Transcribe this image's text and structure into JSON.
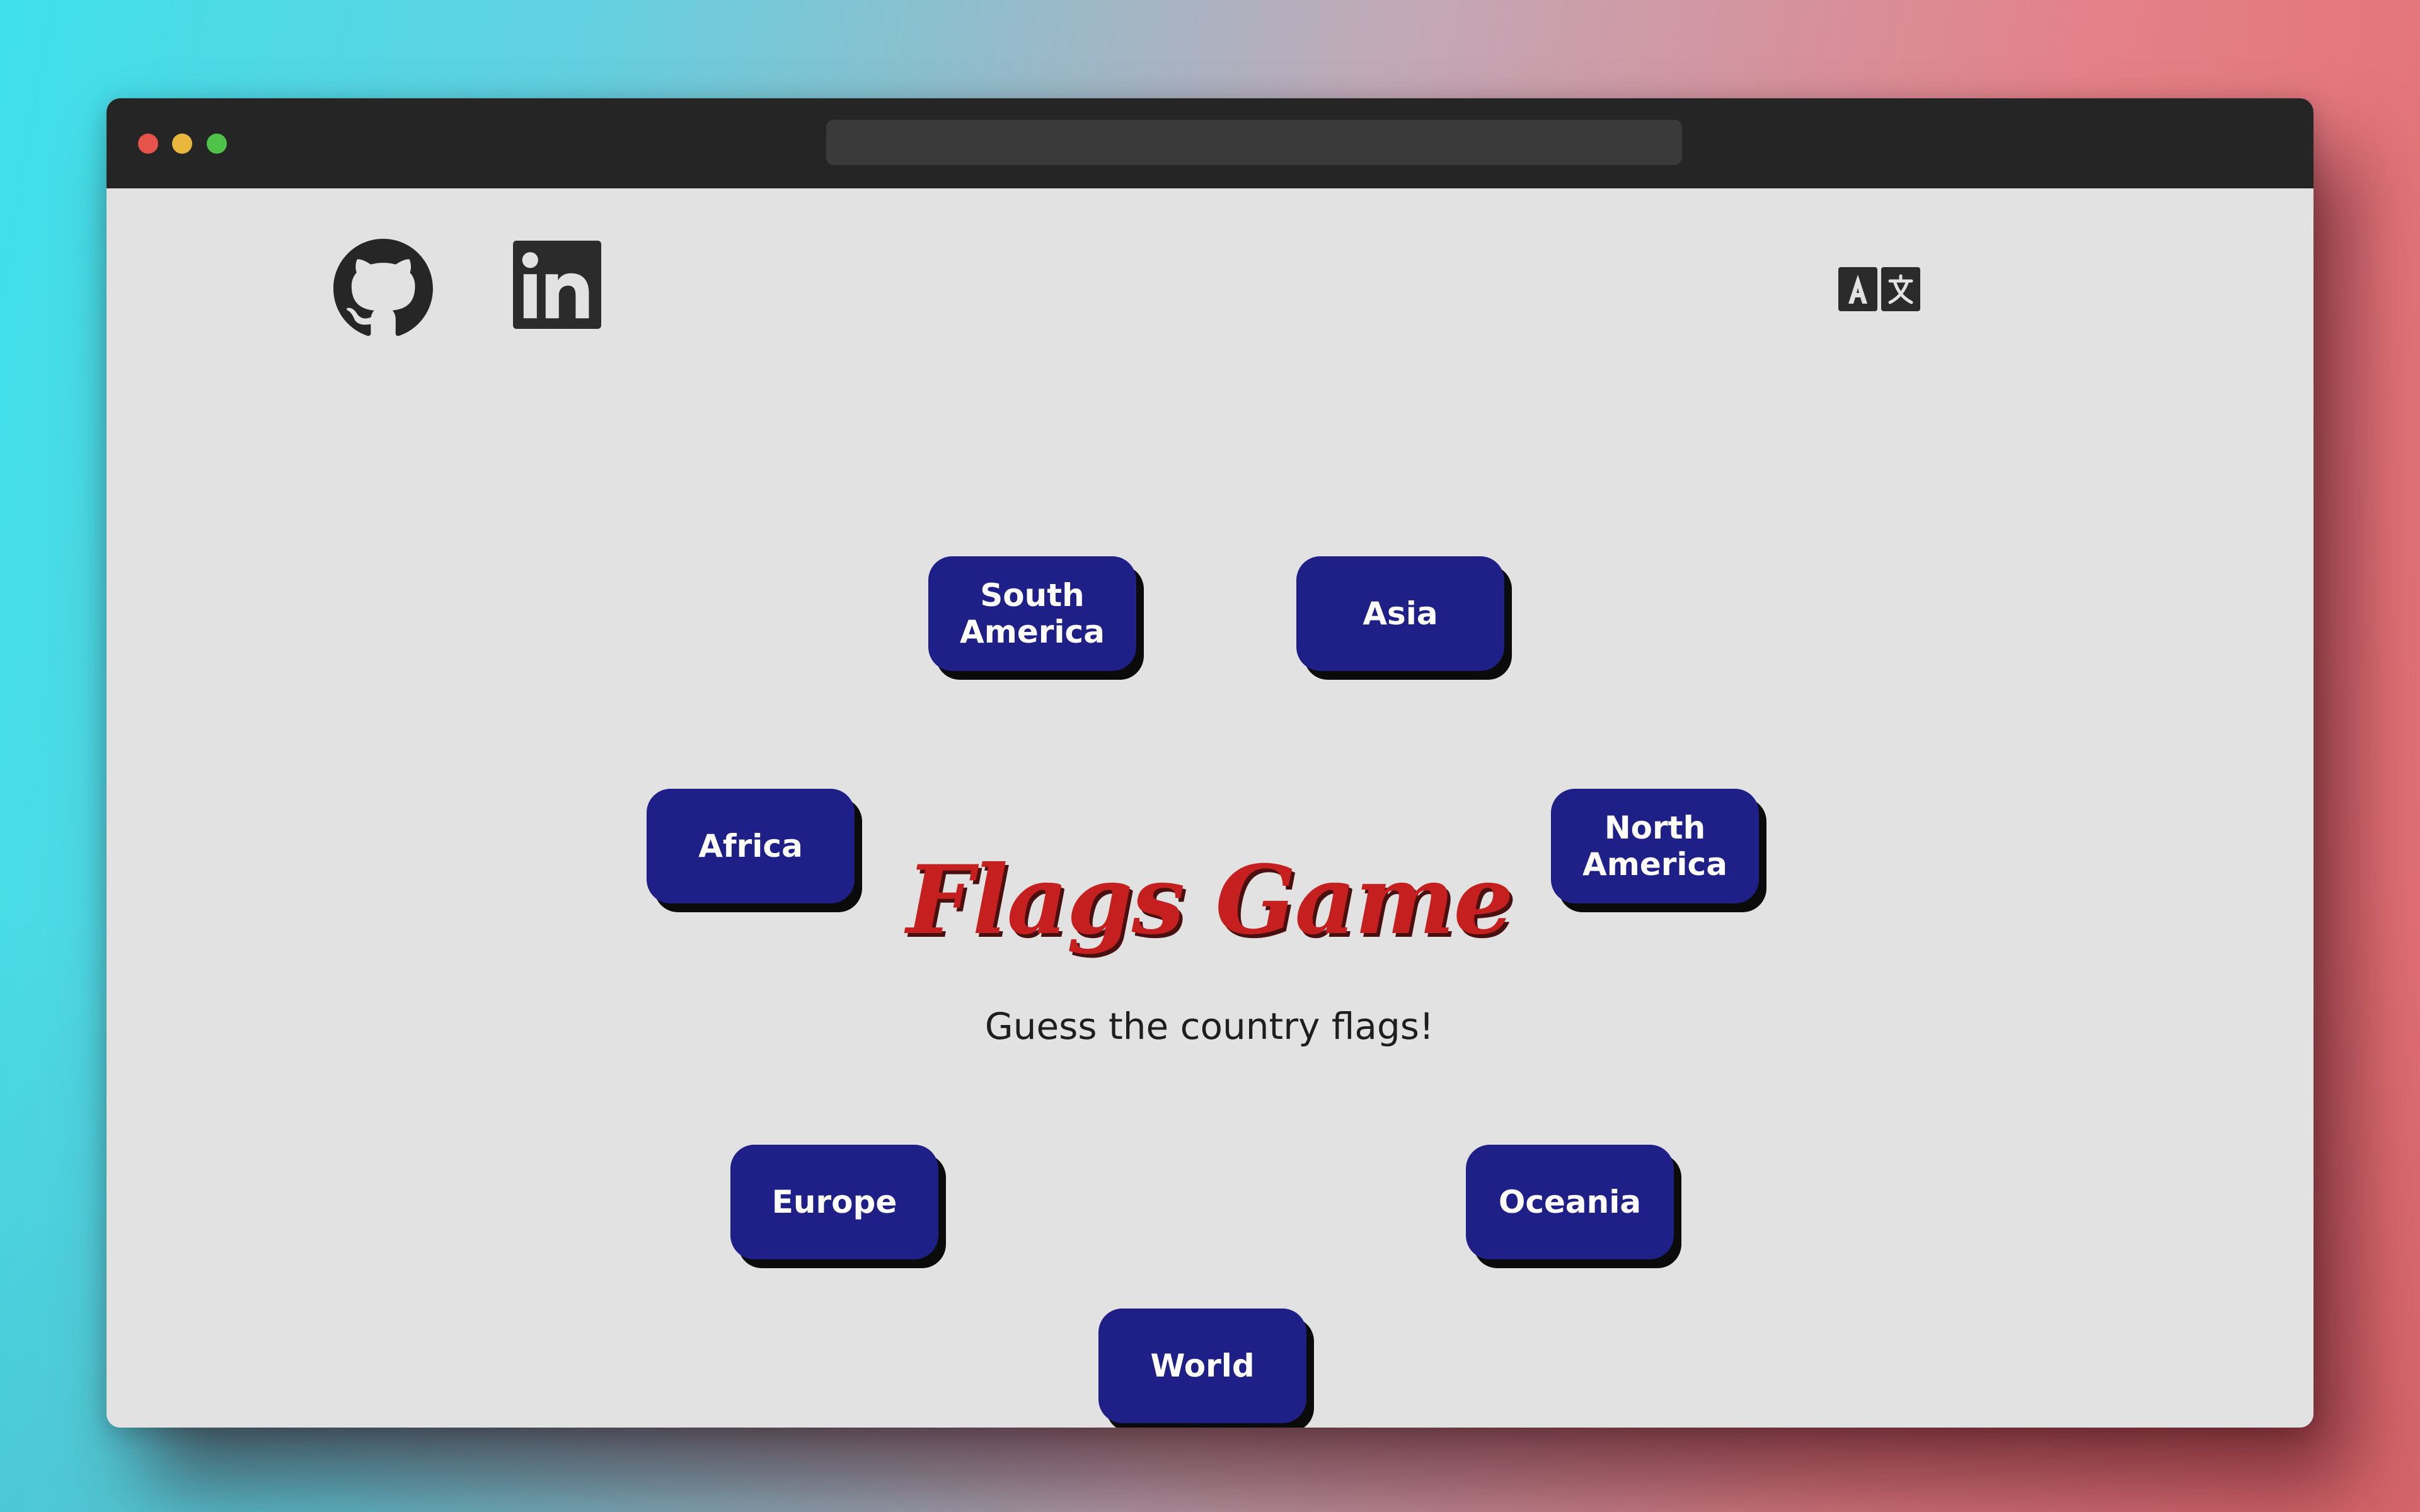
{
  "window": {
    "traffic_lights": [
      "close",
      "minimize",
      "zoom"
    ]
  },
  "header": {
    "github_icon": "github-icon",
    "linkedin_icon": "linkedin-icon",
    "translate_icon": "translate-icon"
  },
  "main": {
    "title": "Flags Game",
    "subtitle": "Guess the country flags!"
  },
  "regions": {
    "south_america": "South\nAmerica",
    "asia": "Asia",
    "africa": "Africa",
    "north_america": "North\nAmerica",
    "europe": "Europe",
    "oceania": "Oceania",
    "world": "World"
  },
  "colors": {
    "button_bg": "#1f1f88",
    "title_red": "#c51f1f",
    "page_bg": "#e2e2e2"
  }
}
